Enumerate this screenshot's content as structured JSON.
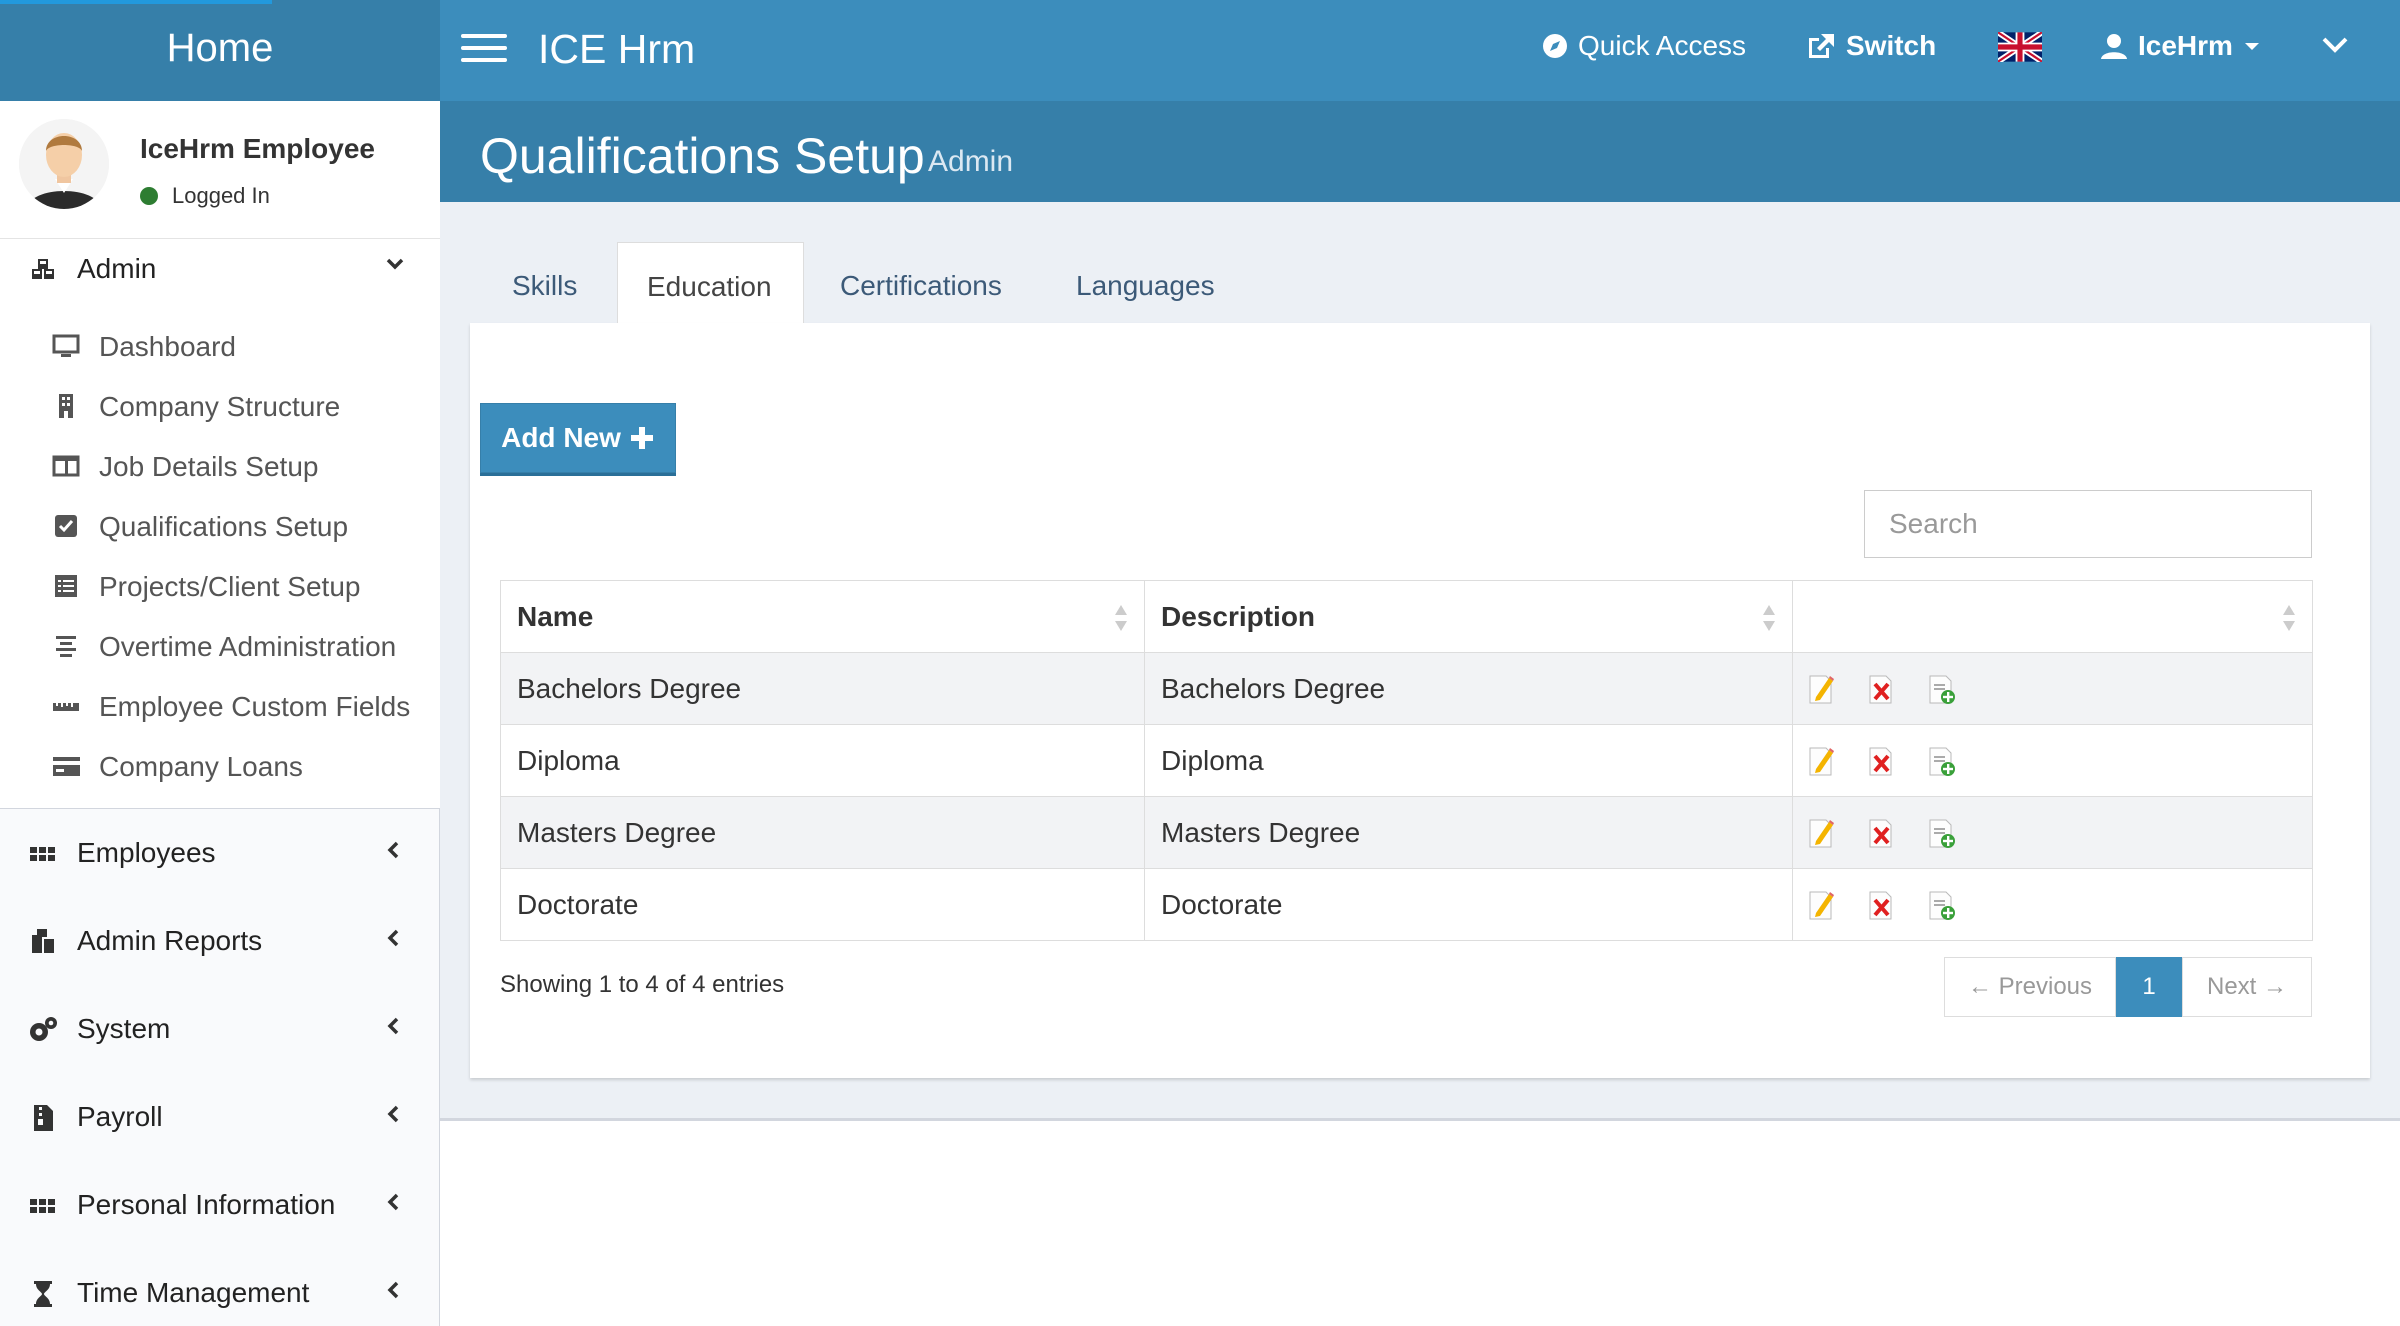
{
  "header": {
    "logo": "Home",
    "app_title": "ICE Hrm",
    "quick_access": "Quick Access",
    "switch": "Switch",
    "user": "IceHrm"
  },
  "sidebar": {
    "user_name": "IceHrm Employee",
    "user_status": "Logged In",
    "admin": {
      "label": "Admin",
      "items": [
        {
          "label": "Dashboard",
          "icon": "monitor-icon"
        },
        {
          "label": "Company Structure",
          "icon": "building-icon"
        },
        {
          "label": "Job Details Setup",
          "icon": "columns-icon"
        },
        {
          "label": "Qualifications Setup",
          "icon": "check-square-icon"
        },
        {
          "label": "Projects/Client Setup",
          "icon": "list-alt-icon"
        },
        {
          "label": "Overtime Administration",
          "icon": "align-center-icon"
        },
        {
          "label": "Employee Custom Fields",
          "icon": "ruler-icon"
        },
        {
          "label": "Company Loans",
          "icon": "credit-card-icon"
        }
      ]
    },
    "groups": [
      {
        "label": "Employees",
        "icon": "grid-icon"
      },
      {
        "label": "Admin Reports",
        "icon": "cubes-icon"
      },
      {
        "label": "System",
        "icon": "cogs-icon"
      },
      {
        "label": "Payroll",
        "icon": "file-zip-icon"
      },
      {
        "label": "Personal Information",
        "icon": "grid-icon"
      },
      {
        "label": "Time Management",
        "icon": "hourglass-icon"
      }
    ]
  },
  "content": {
    "title": "Qualifications Setup",
    "subtitle": "Admin",
    "tabs": [
      {
        "label": "Skills",
        "active": false
      },
      {
        "label": "Education",
        "active": true
      },
      {
        "label": "Certifications",
        "active": false
      },
      {
        "label": "Languages",
        "active": false
      }
    ],
    "add_new": "Add New",
    "search_placeholder": "Search",
    "table": {
      "columns": [
        "Name",
        "Description",
        ""
      ],
      "rows": [
        {
          "name": "Bachelors Degree",
          "description": "Bachelors Degree"
        },
        {
          "name": "Diploma",
          "description": "Diploma"
        },
        {
          "name": "Masters Degree",
          "description": "Masters Degree"
        },
        {
          "name": "Doctorate",
          "description": "Doctorate"
        }
      ]
    },
    "info": "Showing 1 to 4 of 4 entries",
    "pager": {
      "previous": "← Previous",
      "current": "1",
      "next": "Next →"
    }
  },
  "colors": {
    "primary": "#3c8dbc",
    "primary_dark": "#367fa9"
  }
}
